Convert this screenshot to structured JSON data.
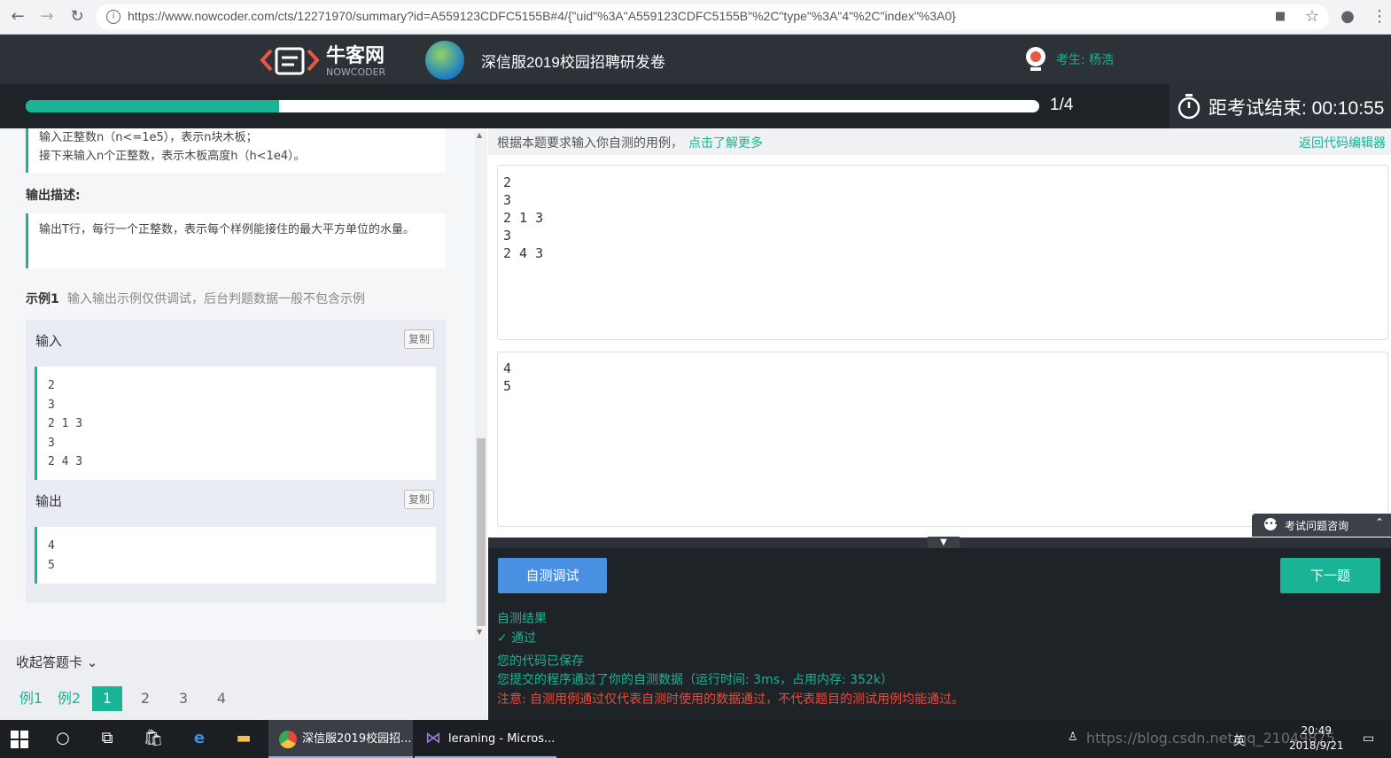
{
  "browser": {
    "url": "https://www.nowcoder.com/cts/12271970/summary?id=A559123CDFC5155B#4/{\"uid\"%3A\"A559123CDFC5155B\"%2C\"type\"%3A\"4\"%2C\"index\"%3A0}"
  },
  "header": {
    "logo_text": "牛客网",
    "logo_sub": "NOWCODER",
    "exam_title": "深信服2019校园招聘研发卷",
    "examinee": "考生: 杨浩"
  },
  "progress": {
    "current": 1,
    "total": 4,
    "label": "1/4",
    "fill_fraction": 0.25
  },
  "timer": {
    "label": "距考试结束: 00:10:55"
  },
  "question": {
    "input_desc_lines": [
      "输入正整数n（n<=1e5），表示n块木板；",
      "接下来输入n个正整数，表示木板高度h（h<1e4）。"
    ],
    "output_label": "输出描述:",
    "output_desc": "输出T行，每行一个正整数，表示每个样例能接住的最大平方单位的水量。",
    "example_label": "示例1",
    "example_note": "输入输出示例仅供调试，后台判题数据一般不包含示例",
    "input_label": "输入",
    "output_label2": "输出",
    "copy_label": "复制",
    "example_input": [
      "2",
      "3",
      "2 1 3",
      "3",
      "2 4 3"
    ],
    "example_output": [
      "4",
      "5"
    ]
  },
  "card": {
    "toggle_label": "收起答题卡 ⌄",
    "items": [
      "例1",
      "例2",
      "1",
      "2",
      "3",
      "4"
    ],
    "active": "1"
  },
  "right": {
    "hint": "根据本题要求输入你自测的用例，",
    "hint_link": "点击了解更多",
    "back_link": "返回代码编辑器",
    "test_input": "2\n3\n2 1 3\n3\n2 4 3",
    "test_output": "4\n5",
    "consult": "考试问题咨询",
    "self_test_btn": "自测调试",
    "next_btn": "下一题"
  },
  "result": {
    "title": "自测结果",
    "pass": "✓  通过",
    "saved": "您的代码已保存",
    "detail": "您提交的程序通过了你的自测数据（运行时间: 3ms，占用内存: 352k）",
    "warning": "注意: 自测用例通过仅代表自测时使用的数据通过，不代表题目的测试用例均能通过。"
  },
  "taskbar": {
    "app1": "深信服2019校园招...",
    "app2": "leraning - Micros...",
    "time": "20:49",
    "date": "2018/9/21",
    "watermark": "https://blog.csdn.net/qq_21049875",
    "ime": "英"
  },
  "colors": {
    "accent": "#19b395",
    "dark": "#2c3238",
    "blue": "#4a90e2",
    "warn": "#e74c3c"
  }
}
